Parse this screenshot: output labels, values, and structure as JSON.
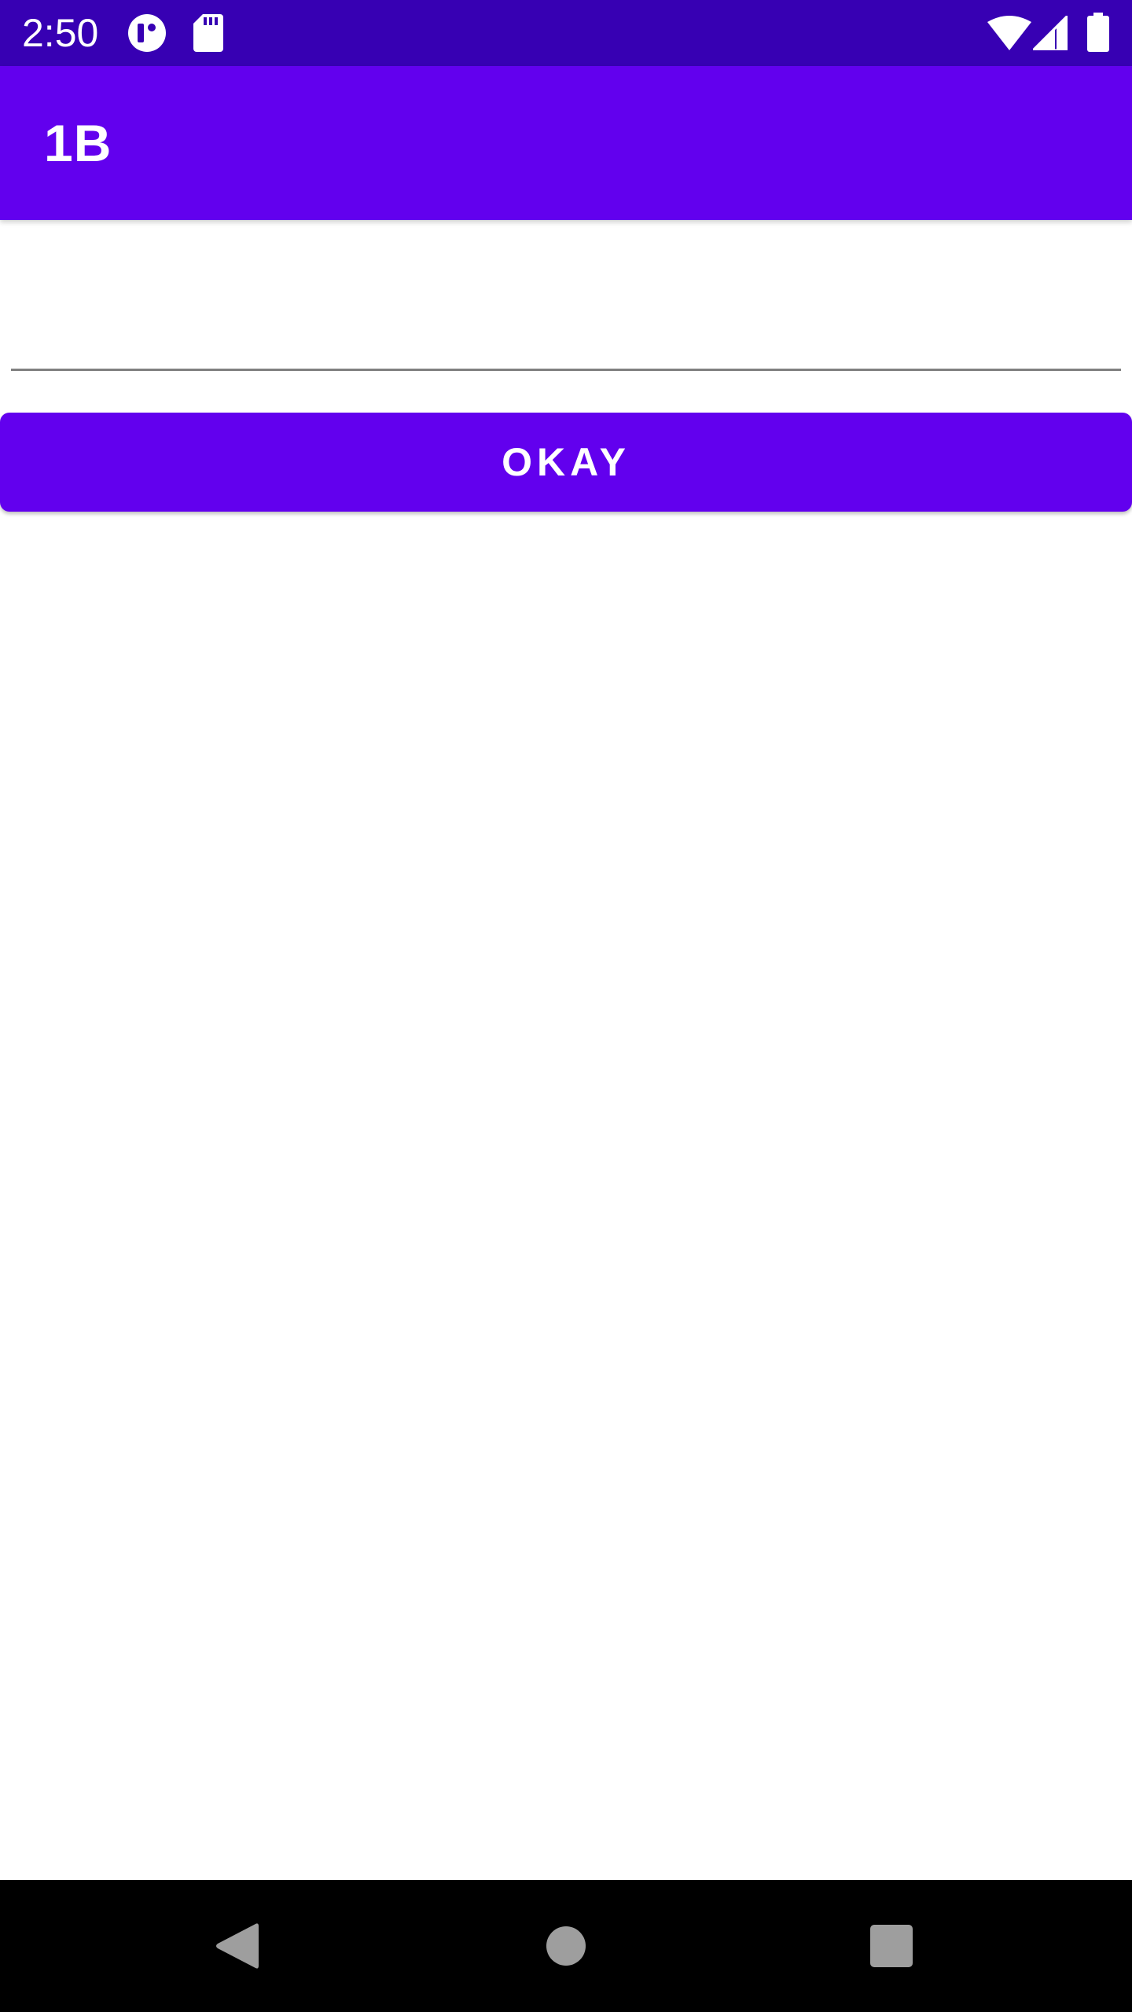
{
  "status_bar": {
    "time": "2:50",
    "left_icons": [
      "data-saver-icon",
      "sd-card-icon"
    ],
    "right_icons": [
      "wifi-icon",
      "cellular-signal-icon",
      "battery-icon"
    ],
    "background_color": "#3700b3"
  },
  "app_bar": {
    "title": "1B",
    "background_color": "#6200ee"
  },
  "form": {
    "text_input_value": "",
    "text_input_placeholder": "",
    "okay_button_label": "OKAY",
    "button_color": "#6200ee"
  },
  "nav_bar": {
    "buttons": [
      "back-icon",
      "home-icon",
      "recents-icon"
    ]
  }
}
